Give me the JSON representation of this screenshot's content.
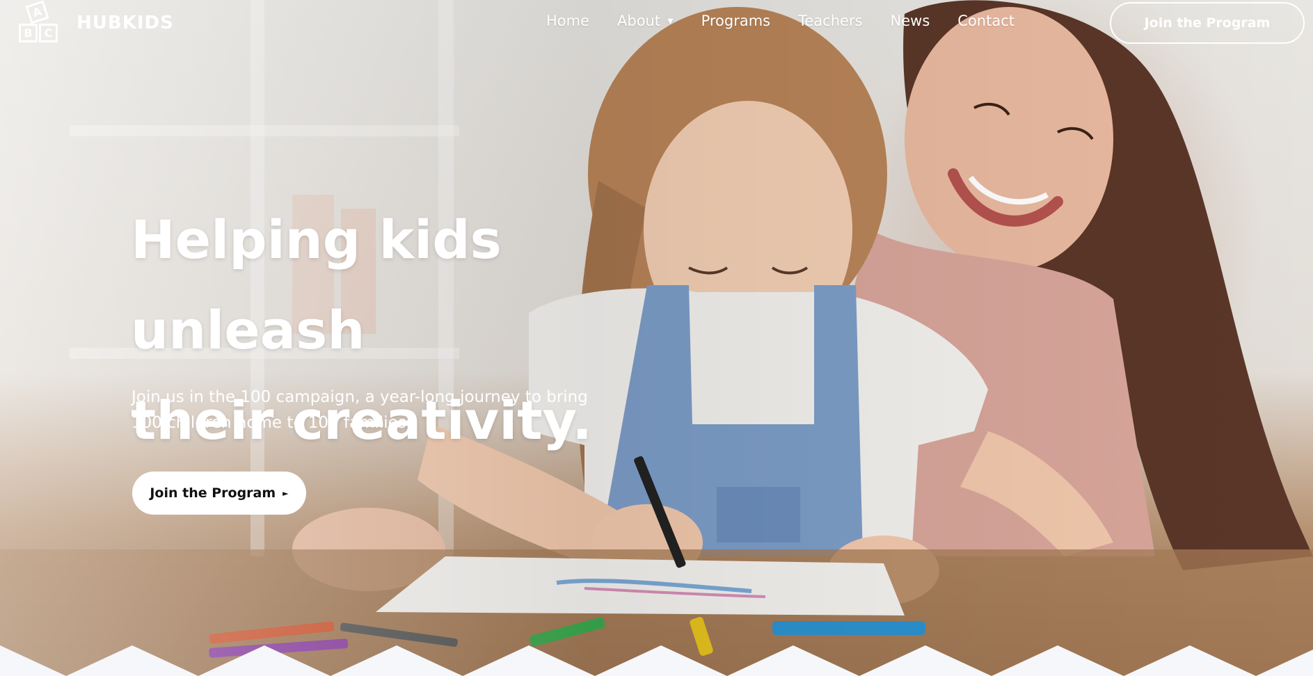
{
  "brand": {
    "blocks": [
      "A",
      "B",
      "C"
    ],
    "name": "HUBKIDS"
  },
  "nav": {
    "home": "Home",
    "about": "About",
    "programs": "Programs",
    "teachers": "Teachers",
    "news": "News",
    "contact": "Contact"
  },
  "header": {
    "cta_label": "Join the Program"
  },
  "hero": {
    "headline_line1": "Helping kids unleash",
    "headline_line2": "their creativity.",
    "subtext_line1": "Join us in the 100 campaign, a year-long journey to bring",
    "subtext_line2": "100 children home to 100 families.",
    "cta_label": "Join the Program"
  },
  "icons": {
    "dropdown": "caret-down-icon",
    "cta_arrow": "play-arrow-icon"
  },
  "colors": {
    "text_on_image": "#ffffff",
    "button_bg": "#ffffff",
    "button_text": "#111111",
    "divider": "#f6f7fb"
  }
}
